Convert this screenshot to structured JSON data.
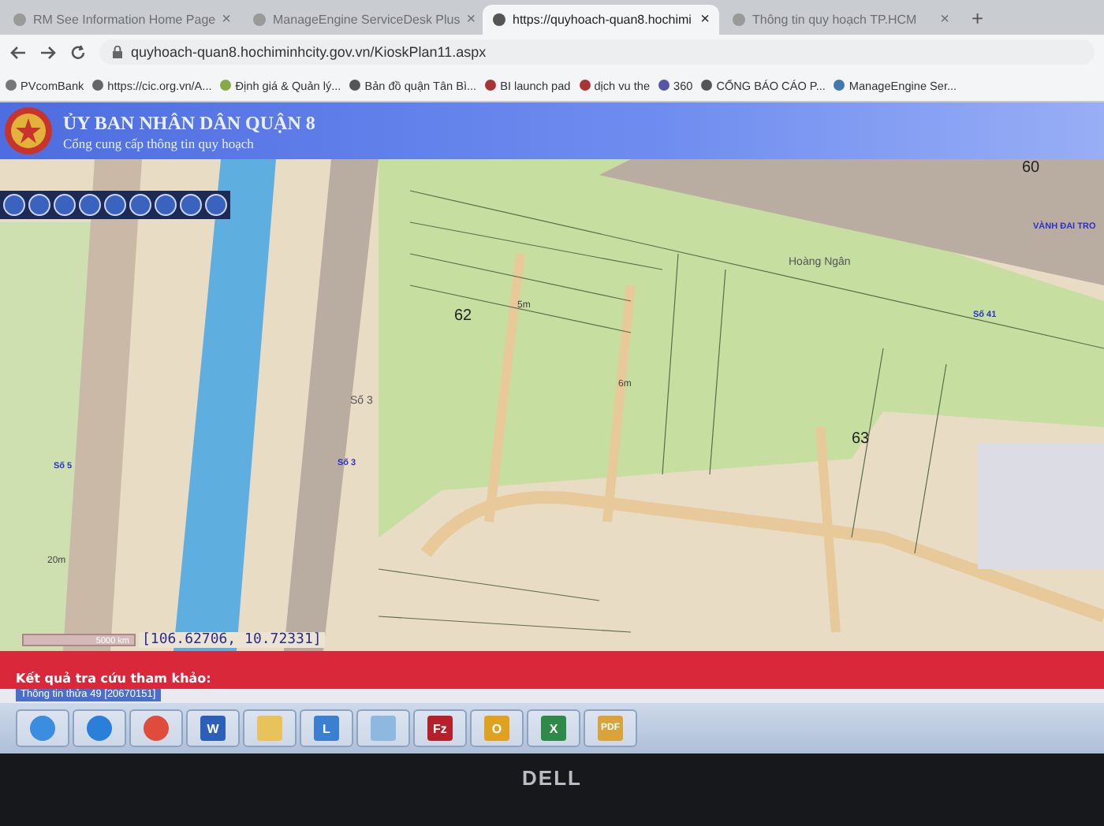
{
  "browser": {
    "tabs": [
      {
        "title": "RM See Information Home Page",
        "close": "×",
        "selected": false
      },
      {
        "title": "ManageEngine ServiceDesk Plus",
        "close": "×",
        "selected": false
      },
      {
        "title": "https://quyhoach-quan8.hochimi",
        "close": "×",
        "selected": true
      },
      {
        "title": "Thông tin quy hoạch TP.HCM",
        "close": "×",
        "selected": false
      }
    ],
    "new_tab": "+",
    "address": "quyhoach-quan8.hochiminhcity.gov.vn/KioskPlan11.aspx",
    "bookmarks": [
      {
        "title": "PVcomBank"
      },
      {
        "title": "https://cic.org.vn/A..."
      },
      {
        "title": "Định giá & Quản lý..."
      },
      {
        "title": "Bản đồ quận Tân Bì..."
      },
      {
        "title": "BI launch pad"
      },
      {
        "title": "dịch vu the"
      },
      {
        "title": "360"
      },
      {
        "title": "CỔNG BÁO CÁO P..."
      },
      {
        "title": "ManageEngine Ser..."
      }
    ]
  },
  "header": {
    "title": "ỦY BAN NHÂN DÂN QUẬN 8",
    "subtitle": "Cổng cung cấp thông tin quy hoạch"
  },
  "map": {
    "labels": [
      {
        "text": "60",
        "kind": "parcel"
      },
      {
        "text": "62",
        "kind": "parcel"
      },
      {
        "text": "63",
        "kind": "parcel"
      },
      {
        "text": "5m",
        "kind": "width"
      },
      {
        "text": "6m",
        "kind": "width"
      },
      {
        "text": "Số 3",
        "kind": "road"
      },
      {
        "text": "Số 3",
        "kind": "street"
      },
      {
        "text": "Số 5",
        "kind": "street"
      },
      {
        "text": "20m",
        "kind": "width"
      },
      {
        "text": "Hoàng Ngân",
        "kind": "road"
      },
      {
        "text": "Số 41",
        "kind": "street"
      },
      {
        "text": "VÀNH ĐAI TRO",
        "kind": "street"
      }
    ],
    "scale": "5000 km",
    "coordinates": "[106.62706, 10.72331]"
  },
  "results": {
    "title": "Kết quả tra cứu tham khảo:",
    "item": "Thông tin thửa 49 [20670151]"
  },
  "taskbar": [
    {
      "kind": "start"
    },
    {
      "kind": "ie"
    },
    {
      "kind": "chrome"
    },
    {
      "kind": "word",
      "glyph": "W"
    },
    {
      "kind": "folder"
    },
    {
      "kind": "lync",
      "glyph": "L"
    },
    {
      "kind": "image"
    },
    {
      "kind": "filezilla",
      "glyph": "Fz"
    },
    {
      "kind": "outlook",
      "glyph": "O"
    },
    {
      "kind": "excel",
      "glyph": "X"
    },
    {
      "kind": "pdf",
      "glyph": "PDF"
    }
  ],
  "monitor": {
    "brand": "DELL"
  }
}
